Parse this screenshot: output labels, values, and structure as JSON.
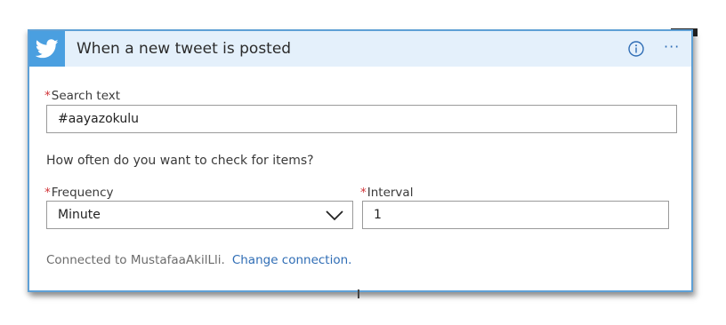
{
  "header": {
    "title": "When a new tweet is posted",
    "icon": "twitter-icon",
    "info_icon": "info-icon",
    "more_icon": "more-options-icon",
    "more_label": "···",
    "colors": {
      "header_bg": "#e4f0fb",
      "icon_bg": "#4a9fe0",
      "border": "#5ea0d6",
      "link": "#2f6db5",
      "required": "#d13438"
    }
  },
  "form": {
    "search": {
      "required_mark": "*",
      "label": "Search text",
      "value": "#aayazokulu"
    },
    "question": "How often do you want to check for items?",
    "frequency": {
      "required_mark": "*",
      "label": "Frequency",
      "value": "Minute"
    },
    "interval": {
      "required_mark": "*",
      "label": "Interval",
      "value": "1"
    }
  },
  "footer": {
    "connected_text": "Connected to MustafaaAkilLli.",
    "change_link": "Change connection."
  }
}
